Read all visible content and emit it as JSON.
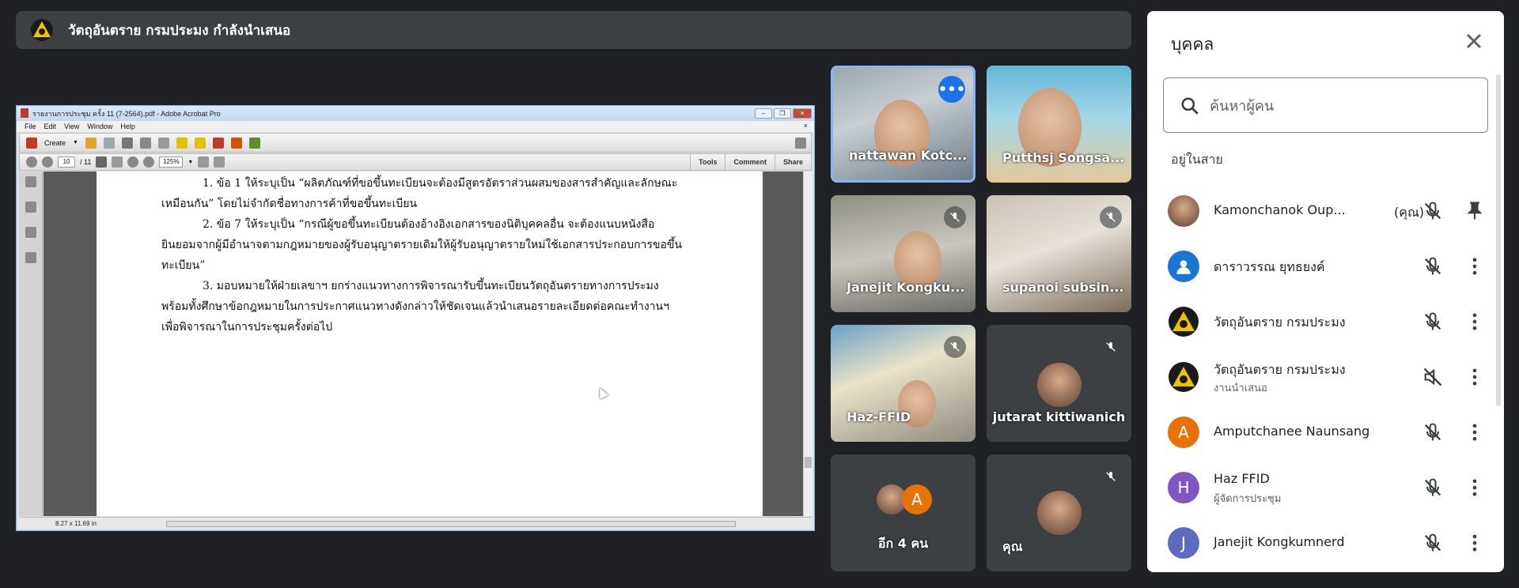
{
  "presenter_bar": {
    "title": "วัตถุอันตราย กรมประมง กำลังนำเสนอ",
    "logo_icon": "dept-fisheries-logo"
  },
  "shared_screen": {
    "window_title": "รายงานการประชุม ครั้ง 11 (7-2564).pdf - Adobe Acrobat Pro",
    "menu": [
      "File",
      "Edit",
      "View",
      "Window",
      "Help"
    ],
    "close_x": "×",
    "create_label": "Create",
    "page_current": "10",
    "page_total": "/ 11",
    "zoom": "125%",
    "right_tabs": [
      "Tools",
      "Comment",
      "Share"
    ],
    "page_size": "8.27 x 11.69 in",
    "doc_lines": [
      "1.  ข้อ 1 ให้ระบุเป็น “ผลิตภัณฑ์ที่ขอขึ้นทะเบียนจะต้องมีสูตรอัตราส่วนผสมของสารสำคัญและลักษณะ",
      "เหมือนกัน” โดยไม่จำกัดชื่อทางการค้าที่ขอขึ้นทะเบียน",
      "2.  ข้อ 7  ให้ระบุเป็น “กรณีผู้ขอขึ้นทะเบียนต้องอ้างอิงเอกสารของนิติบุคคลอื่น  จะต้องแนบหนังสือ",
      "ยินยอมจากผู้มีอำนาจตามกฎหมายของผู้รับอนุญาตรายเดิมให้ผู้รับอนุญาตรายใหม่ใช้เอกสารประกอบการขอขึ้น",
      "ทะเบียน”",
      "3.    มอบหมายให้ฝ่ายเลขาฯ ยกร่างแนวทางการพิจารณารับขึ้นทะเบียนวัตถุอันตรายทางการประมง",
      "พร้อมทั้งศึกษาข้อกฎหมายในการประกาศแนวทางดังกล่าวให้ชัดเจนแล้วนำเสนอรายละเอียดต่อคณะทำงานฯ",
      "เพื่อพิจารณาในการประชุมครั้งต่อไป"
    ]
  },
  "tiles": [
    {
      "name": "nattawan Kotc...",
      "more": "•••"
    },
    {
      "name": "Putthsj Songsa..."
    },
    {
      "name": "Janejit Kongku..."
    },
    {
      "name": "supanoi subsin..."
    },
    {
      "name": "Haz-FFID"
    },
    {
      "name": "jutarat kittiwanich"
    },
    {
      "name": "อีก 4 คน",
      "avatar_letter": "A"
    },
    {
      "name": "คุณ"
    }
  ],
  "panel": {
    "title": "บุคคล",
    "search_placeholder": "ค้นหาผู้คน",
    "section": "อยู่ในสาย",
    "people": [
      {
        "name": "Kamonchanok Oup...",
        "tag": "(คุณ)",
        "action": "pin-icon"
      },
      {
        "name": "ดาราวรรณ ยุทธยงค์",
        "action": "more-vert-icon"
      },
      {
        "name": "วัตถุอันตราย กรมประมง",
        "action": "more-vert-icon"
      },
      {
        "name": "วัตถุอันตราย กรมประมง",
        "sub": "งานนำเสนอ",
        "action": "more-vert-icon"
      },
      {
        "name": "Amputchanee Naunsang",
        "letter": "A",
        "color": "#e8710a",
        "action": "more-vert-icon"
      },
      {
        "name": "Haz FFID",
        "sub": "ผู้จัดการประชุม",
        "letter": "H",
        "color": "#7e57c2",
        "action": "more-vert-icon"
      },
      {
        "name": "Janejit Kongkumnerd",
        "letter": "J",
        "color": "#5c6bc0",
        "action": "more-vert-icon"
      }
    ]
  },
  "colors": {
    "bg": "#202124",
    "tile": "#3c4043",
    "accent": "#1a73e8",
    "panel": "#ffffff"
  }
}
